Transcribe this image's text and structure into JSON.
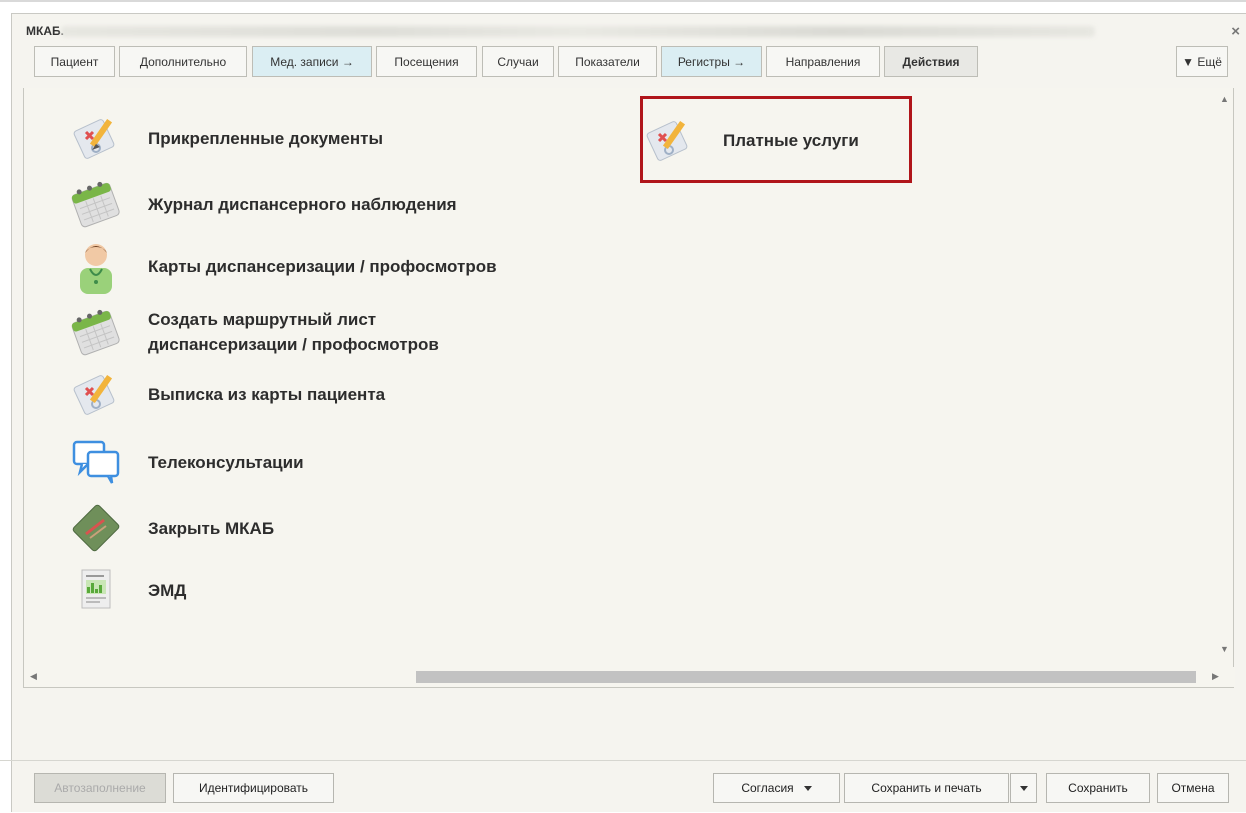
{
  "window": {
    "title": "МКАБ.",
    "close_glyph": "×"
  },
  "tabs": [
    {
      "label": "Пациент"
    },
    {
      "label": "Дополнительно"
    },
    {
      "label": "Мед. записи →"
    },
    {
      "label": "Посещения"
    },
    {
      "label": "Случаи"
    },
    {
      "label": "Показатели"
    },
    {
      "label": "Регистры →"
    },
    {
      "label": "Направления"
    },
    {
      "label": "Действия"
    }
  ],
  "more_tab": "▼ Ещё",
  "actions": [
    {
      "label": "Прикрепленные документы",
      "icon": "document-pencil-icon"
    },
    {
      "label": "Журнал диспансерного наблюдения",
      "icon": "calendar-icon"
    },
    {
      "label": "Карты диспансеризации / профосмотров",
      "icon": "doctor-icon"
    },
    {
      "label_line1": "Создать маршрутный лист",
      "label_line2": "диспансеризации / профосмотров",
      "icon": "calendar-icon"
    },
    {
      "label": "Выписка из карты пациента",
      "icon": "document-pencil-icon"
    },
    {
      "label": "Телеконсультации",
      "icon": "chat-bubbles-icon"
    },
    {
      "label": "Закрыть МКАБ",
      "icon": "closed-card-icon"
    },
    {
      "label": "ЭМД",
      "icon": "report-document-icon"
    },
    {
      "label": "Платные услуги",
      "icon": "document-pencil-icon"
    }
  ],
  "footer": {
    "autofill": "Автозаполнение",
    "identify": "Идентифицировать",
    "consents": "Согласия",
    "save_print": "Сохранить и печать",
    "save": "Сохранить",
    "cancel": "Отмена"
  },
  "colors": {
    "highlight": "#b0151a",
    "tab_blue": "#dbeef3"
  }
}
